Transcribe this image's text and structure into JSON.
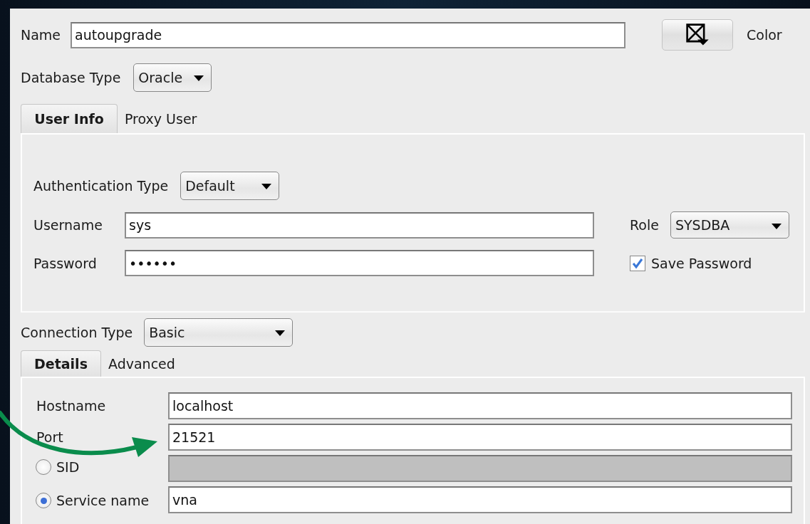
{
  "name_field": {
    "label": "Name",
    "value": "autoupgrade"
  },
  "color_picker": {
    "label": "Color"
  },
  "database_type": {
    "label": "Database Type",
    "value": "Oracle"
  },
  "tabs": [
    {
      "label": "User Info",
      "selected": true
    },
    {
      "label": "Proxy User",
      "selected": false
    }
  ],
  "user_info": {
    "authentication_type": {
      "label": "Authentication Type",
      "value": "Default"
    },
    "username": {
      "label": "Username",
      "value": "sys"
    },
    "role": {
      "label": "Role",
      "value": "SYSDBA"
    },
    "password": {
      "label": "Password",
      "value": "••••••"
    },
    "save_password": {
      "label": "Save Password",
      "checked": true
    }
  },
  "connection_type": {
    "label": "Connection Type",
    "value": "Basic"
  },
  "detail_tabs": [
    {
      "label": "Details",
      "selected": true
    },
    {
      "label": "Advanced",
      "selected": false
    }
  ],
  "details": [
    {
      "kind": "field",
      "label": "Hostname",
      "value": "localhost"
    },
    {
      "kind": "field",
      "label": "Port",
      "value": "21521"
    },
    {
      "kind": "radio",
      "label": "SID",
      "selected": false
    },
    {
      "kind": "radio",
      "label": "Service name",
      "selected": true,
      "value": "vna"
    }
  ]
}
